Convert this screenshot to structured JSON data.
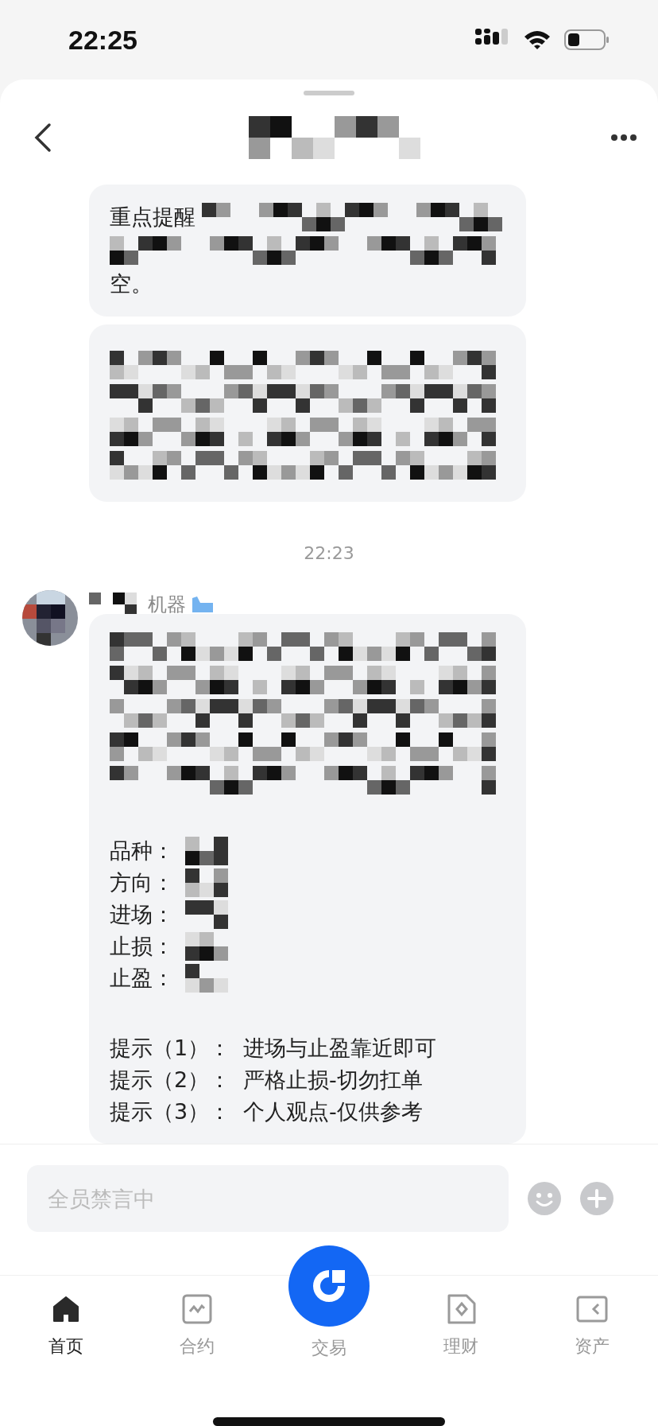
{
  "status_bar": {
    "time": "22:25"
  },
  "messages": [
    {
      "kind": "bubble",
      "parts": [
        {
          "kind": "lines",
          "lines": [
            {
              "segments": [
                {
                  "kind": "text",
                  "text": "重点提醒"
                },
                {
                  "kind": "mosaic"
                }
              ]
            },
            {
              "segments": [
                {
                  "kind": "mosaic"
                }
              ]
            },
            {
              "segments": [
                {
                  "kind": "text",
                  "text": "空。"
                }
              ]
            }
          ]
        }
      ]
    },
    {
      "kind": "bubble",
      "parts": [
        {
          "kind": "lines",
          "lines": [
            {
              "segments": [
                {
                  "kind": "mosaic"
                }
              ]
            },
            {
              "segments": [
                {
                  "kind": "mosaic"
                }
              ]
            },
            {
              "segments": [
                {
                  "kind": "mosaic"
                }
              ]
            },
            {
              "segments": [
                {
                  "kind": "mosaic"
                }
              ]
            }
          ]
        }
      ]
    },
    {
      "kind": "time",
      "text": "22:23"
    },
    {
      "kind": "sender",
      "name": "机器"
    },
    {
      "kind": "bubble",
      "parts": [
        {
          "kind": "lines",
          "lines": [
            {
              "segments": [
                {
                  "kind": "mosaic"
                }
              ]
            },
            {
              "segments": [
                {
                  "kind": "mosaic"
                }
              ]
            },
            {
              "segments": [
                {
                  "kind": "mosaic"
                }
              ]
            },
            {
              "segments": [
                {
                  "kind": "mosaic"
                }
              ]
            },
            {
              "segments": [
                {
                  "kind": "mosaic"
                }
              ]
            }
          ]
        },
        {
          "kind": "fields",
          "items": [
            {
              "label": "品种："
            },
            {
              "label": "方向："
            },
            {
              "label": "进场："
            },
            {
              "label": "止损："
            },
            {
              "label": "止盈："
            }
          ]
        },
        {
          "kind": "tips",
          "items": [
            {
              "label": "提示（1）：",
              "text": "进场与止盈靠近即可"
            },
            {
              "label": "提示（2）：",
              "text": "严格止损-切勿扛单"
            },
            {
              "label": "提示（3）：",
              "text": "个人观点-仅供参考"
            }
          ]
        }
      ]
    }
  ],
  "composer": {
    "placeholder": "全员禁言中"
  },
  "tabs": [
    {
      "label": "首页",
      "kind": "home",
      "selected": true
    },
    {
      "label": "合约",
      "kind": "chart",
      "selected": false
    },
    {
      "label": "交易",
      "kind": "trade",
      "selected": false
    },
    {
      "label": "理财",
      "kind": "diamond",
      "selected": false
    },
    {
      "label": "资产",
      "kind": "wallet",
      "selected": false
    }
  ]
}
